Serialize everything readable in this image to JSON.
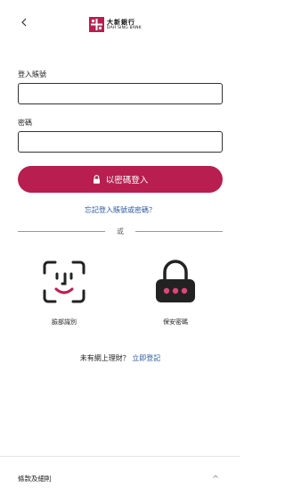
{
  "header": {
    "back_icon": "chevron-left-icon",
    "logo_cn": "大新銀行",
    "logo_en": "DAH SING BANK",
    "brand_color": "#b81e4f"
  },
  "form": {
    "username_label": "登入賬號",
    "username_value": "",
    "password_label": "密碼",
    "password_value": "",
    "login_button_label": "以密碼登入",
    "login_icon": "lock-icon",
    "forgot_link": "忘記登入賬號或密碼？",
    "link_color": "#2c5aa0"
  },
  "divider": {
    "or_label": "或"
  },
  "biometrics": {
    "face_label": "臉部識別",
    "face_icon": "face-id-icon",
    "pin_label": "保安密碼",
    "pin_icon": "security-pin-icon"
  },
  "signup": {
    "prompt": "未有網上理財？",
    "link": "立即登記"
  },
  "footer": {
    "terms_label": "條款及細則",
    "expand_icon": "chevron-up-icon"
  }
}
